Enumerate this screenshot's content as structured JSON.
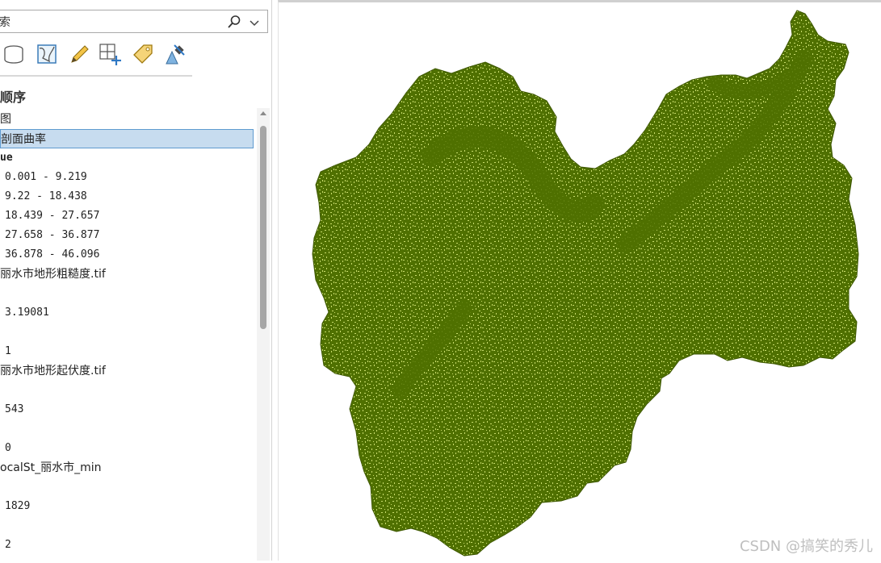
{
  "search": {
    "visible_text": "索",
    "placeholder": ""
  },
  "toolbar": {
    "tools": [
      "database-icon",
      "map-layer-icon",
      "edit-pencil-icon",
      "add-grid-icon",
      "label-tag-icon",
      "satellite-icon"
    ]
  },
  "contents": {
    "header": "顺序",
    "rows": [
      {
        "text": "图",
        "mono": false
      },
      {
        "text": "剖面曲率",
        "mono": false,
        "selected": true
      },
      {
        "text": "ue",
        "mono": true,
        "bold": true
      },
      {
        "text": "0.001 - 9.219",
        "mono": true,
        "indent": true
      },
      {
        "text": "9.22 - 18.438",
        "mono": true,
        "indent": true
      },
      {
        "text": "18.439 - 27.657",
        "mono": true,
        "indent": true
      },
      {
        "text": "27.658 - 36.877",
        "mono": true,
        "indent": true
      },
      {
        "text": "36.878 - 46.096",
        "mono": true,
        "indent": true
      },
      {
        "text": "丽水市地形粗糙度.tif",
        "mono": false
      },
      {
        "text": "",
        "mono": true
      },
      {
        "text": "3.19081",
        "mono": true,
        "indent": true
      },
      {
        "text": "",
        "mono": true
      },
      {
        "text": "1",
        "mono": true,
        "indent": true
      },
      {
        "text": "丽水市地形起伏度.tif",
        "mono": false
      },
      {
        "text": "",
        "mono": true
      },
      {
        "text": "543",
        "mono": true,
        "indent": true
      },
      {
        "text": "",
        "mono": true
      },
      {
        "text": "0",
        "mono": true,
        "indent": true
      },
      {
        "text": "ocalSt_丽水市_min",
        "mono": false
      },
      {
        "text": "",
        "mono": true
      },
      {
        "text": "1829",
        "mono": true,
        "indent": true
      },
      {
        "text": "",
        "mono": true
      },
      {
        "text": "2",
        "mono": true,
        "indent": true
      }
    ]
  },
  "map": {
    "dark_color": "#4f7000",
    "light_color": "#c8dc6e"
  },
  "watermark": "CSDN @搞笑的秀儿"
}
